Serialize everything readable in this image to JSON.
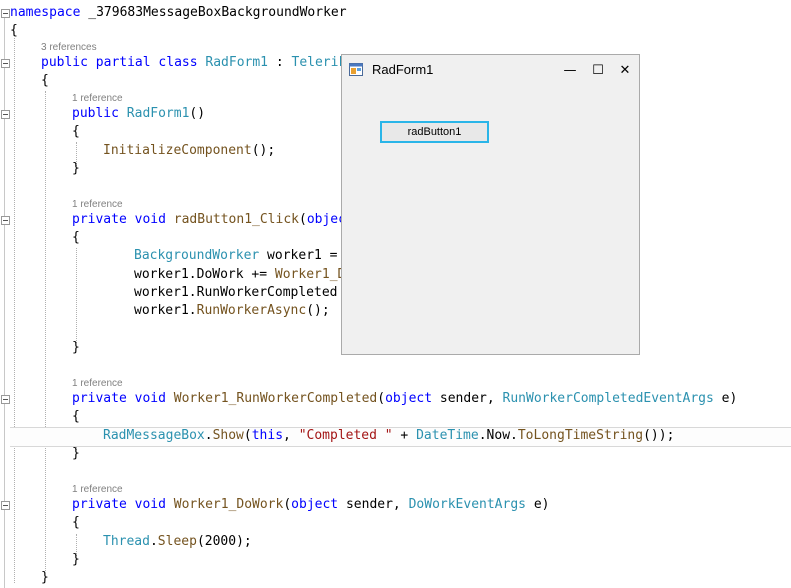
{
  "editor": {
    "lines": [
      {
        "id": "l1",
        "segs": [
          {
            "c": "kw",
            "t": "namespace"
          },
          {
            "c": "",
            "t": " _379683MessageBoxBackgroundWorker"
          }
        ]
      },
      {
        "id": "l2",
        "segs": [
          {
            "c": "",
            "t": "{"
          }
        ]
      },
      {
        "id": "l3",
        "segs": [
          {
            "c": "kw",
            "t": "public"
          },
          {
            "c": "",
            "t": " "
          },
          {
            "c": "kw",
            "t": "partial"
          },
          {
            "c": "",
            "t": " "
          },
          {
            "c": "kw",
            "t": "class"
          },
          {
            "c": "",
            "t": " "
          },
          {
            "c": "ty",
            "t": "RadForm1"
          },
          {
            "c": "",
            "t": " : "
          },
          {
            "c": "ty",
            "t": "Telerik"
          }
        ]
      },
      {
        "id": "l4",
        "segs": [
          {
            "c": "",
            "t": "{"
          }
        ]
      },
      {
        "id": "l5",
        "segs": [
          {
            "c": "kw",
            "t": "public"
          },
          {
            "c": "",
            "t": " "
          },
          {
            "c": "ty",
            "t": "RadForm1"
          },
          {
            "c": "",
            "t": "()"
          }
        ]
      },
      {
        "id": "l6",
        "segs": [
          {
            "c": "",
            "t": "{"
          }
        ]
      },
      {
        "id": "l7",
        "segs": [
          {
            "c": "fn",
            "t": "InitializeComponent"
          },
          {
            "c": "",
            "t": "();"
          }
        ]
      },
      {
        "id": "l8",
        "segs": [
          {
            "c": "",
            "t": "}"
          }
        ]
      },
      {
        "id": "l9",
        "segs": [
          {
            "c": "kw",
            "t": "private"
          },
          {
            "c": "",
            "t": " "
          },
          {
            "c": "kw",
            "t": "void"
          },
          {
            "c": "",
            "t": " "
          },
          {
            "c": "fn",
            "t": "radButton1_Click"
          },
          {
            "c": "",
            "t": "("
          },
          {
            "c": "kw",
            "t": "objec"
          }
        ]
      },
      {
        "id": "l10",
        "segs": [
          {
            "c": "",
            "t": "{"
          }
        ]
      },
      {
        "id": "l11",
        "segs": [
          {
            "c": "ty",
            "t": "BackgroundWorker"
          },
          {
            "c": "",
            "t": " worker1 ="
          }
        ]
      },
      {
        "id": "l12",
        "segs": [
          {
            "c": "",
            "t": "worker1."
          },
          {
            "c": "",
            "t": "DoWork"
          },
          {
            "c": "",
            "t": " += "
          },
          {
            "c": "fn",
            "t": "Worker1_D"
          }
        ]
      },
      {
        "id": "l13",
        "segs": [
          {
            "c": "",
            "t": "worker1.RunWorkerCompleted"
          }
        ]
      },
      {
        "id": "l14",
        "segs": [
          {
            "c": "",
            "t": "worker1."
          },
          {
            "c": "fn",
            "t": "RunWorkerAsync"
          },
          {
            "c": "",
            "t": "();"
          }
        ]
      },
      {
        "id": "l15",
        "segs": [
          {
            "c": "",
            "t": "}"
          }
        ]
      },
      {
        "id": "l16",
        "segs": [
          {
            "c": "kw",
            "t": "private"
          },
          {
            "c": "",
            "t": " "
          },
          {
            "c": "kw",
            "t": "void"
          },
          {
            "c": "",
            "t": " "
          },
          {
            "c": "fn",
            "t": "Worker1_RunWorkerCompleted"
          },
          {
            "c": "",
            "t": "("
          },
          {
            "c": "kw",
            "t": "object"
          },
          {
            "c": "",
            "t": " sender, "
          },
          {
            "c": "ty",
            "t": "RunWorkerCompletedEventArgs"
          },
          {
            "c": "",
            "t": " e)"
          }
        ]
      },
      {
        "id": "l17",
        "segs": [
          {
            "c": "",
            "t": "{"
          }
        ]
      },
      {
        "id": "l18",
        "segs": [
          {
            "c": "ty",
            "t": "RadMessageBox"
          },
          {
            "c": "",
            "t": "."
          },
          {
            "c": "fn",
            "t": "Show"
          },
          {
            "c": "",
            "t": "("
          },
          {
            "c": "kw",
            "t": "this"
          },
          {
            "c": "",
            "t": ", "
          },
          {
            "c": "str",
            "t": "\"Completed \""
          },
          {
            "c": "",
            "t": " + "
          },
          {
            "c": "ty",
            "t": "DateTime"
          },
          {
            "c": "",
            "t": ".Now."
          },
          {
            "c": "fn",
            "t": "ToLongTimeString"
          },
          {
            "c": "",
            "t": "());"
          }
        ]
      },
      {
        "id": "l19",
        "segs": [
          {
            "c": "",
            "t": "}"
          }
        ]
      },
      {
        "id": "l20",
        "segs": [
          {
            "c": "kw",
            "t": "private"
          },
          {
            "c": "",
            "t": " "
          },
          {
            "c": "kw",
            "t": "void"
          },
          {
            "c": "",
            "t": " "
          },
          {
            "c": "fn",
            "t": "Worker1_DoWork"
          },
          {
            "c": "",
            "t": "("
          },
          {
            "c": "kw",
            "t": "object"
          },
          {
            "c": "",
            "t": " sender, "
          },
          {
            "c": "ty",
            "t": "DoWorkEventArgs"
          },
          {
            "c": "",
            "t": " e)"
          }
        ]
      },
      {
        "id": "l21",
        "segs": [
          {
            "c": "",
            "t": "{"
          }
        ]
      },
      {
        "id": "l22",
        "segs": [
          {
            "c": "ty",
            "t": "Thread"
          },
          {
            "c": "",
            "t": "."
          },
          {
            "c": "fn",
            "t": "Sleep"
          },
          {
            "c": "",
            "t": "("
          },
          {
            "c": "num",
            "t": "2000"
          },
          {
            "c": "",
            "t": ");"
          }
        ]
      },
      {
        "id": "l23",
        "segs": [
          {
            "c": "",
            "t": "}"
          }
        ]
      },
      {
        "id": "l24",
        "segs": [
          {
            "c": "",
            "t": "}"
          }
        ]
      }
    ],
    "codelens": {
      "class_refs": "3 references",
      "ctor_refs": "1 reference",
      "click_refs": "1 reference",
      "completed_refs": "1 reference",
      "dowork_refs": "1 reference"
    },
    "colors": {
      "keyword": "#0000ff",
      "type": "#2b91af",
      "method": "#74531f",
      "string": "#a31515"
    }
  },
  "form_window": {
    "title": "RadForm1",
    "minimize_glyph": "—",
    "maximize_glyph": "☐",
    "close_glyph": "✕",
    "button_label": "radButton1",
    "accent_border": "#2ab5e8"
  }
}
